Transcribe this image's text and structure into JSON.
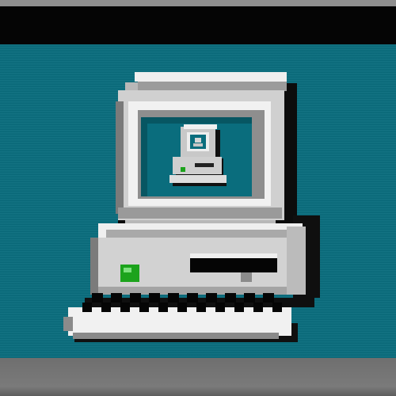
{
  "screen": {
    "desktop_color": "#0a6d7d",
    "title_bar_color": "#050505",
    "bottom_bar_color": "#777777"
  },
  "desktop_icon": {
    "icon": "my-computer-icon",
    "nested_icon": "small-my-computer-icon",
    "power_light_color": "#1ca31c"
  }
}
